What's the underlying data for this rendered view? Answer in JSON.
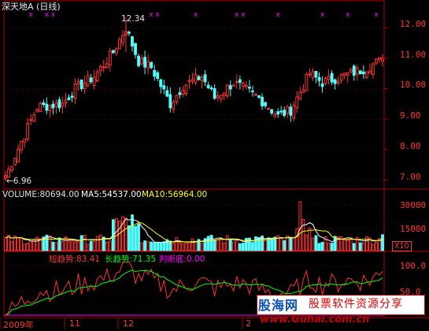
{
  "stock": {
    "title": "深天地A (日线)"
  },
  "price_panel": {
    "y_ticks": [
      "12.00",
      "11.00",
      "10.00",
      "9.00",
      "8.00",
      "7.00"
    ],
    "high_annotation": "12.34",
    "low_annotation": "←6.96"
  },
  "volume_panel": {
    "label_volume": "VOLUME:80694.00",
    "label_ma5": "MA5:54537.00",
    "label_ma10": "MA10:56964.00",
    "y_ticks": [
      "30000",
      "15000"
    ],
    "unit_badge": "X10"
  },
  "indicator_panel": {
    "label_short": "短趋势:83.41",
    "label_long": "长趋势:71.35",
    "label_judge": "判断底:0.00",
    "y_ticks": [
      "100.0",
      "50.0"
    ]
  },
  "x_axis": {
    "labels": [
      "2009年",
      "11",
      "12",
      "2"
    ]
  },
  "watermark": {
    "logo": "股海网",
    "slogan": "股票软件资源分享",
    "url": "www.Guhai.com.cn"
  },
  "colors": {
    "up": "#ff3232",
    "down": "#54fcfc",
    "background": "#000000",
    "ma5": "#ffffff",
    "ma10": "#ffff00",
    "short_trend": "#ff3232",
    "long_trend": "#00ff00",
    "judge": "#ff00ff",
    "marker": "#ff00ff"
  },
  "chart_data": {
    "type": "candlestick",
    "price_range": [
      6.7,
      12.6
    ],
    "candle_count": 120,
    "high": 12.34,
    "low": 6.96,
    "close_path_keypoints": [
      [
        0,
        7.1
      ],
      [
        6,
        8.5
      ],
      [
        10,
        9.4
      ],
      [
        18,
        9.5
      ],
      [
        22,
        10.0
      ],
      [
        28,
        10.4
      ],
      [
        34,
        11.2
      ],
      [
        38,
        12.0
      ],
      [
        42,
        10.9
      ],
      [
        46,
        10.7
      ],
      [
        52,
        9.5
      ],
      [
        56,
        10.1
      ],
      [
        62,
        10.4
      ],
      [
        66,
        9.7
      ],
      [
        72,
        10.2
      ],
      [
        80,
        9.7
      ],
      [
        86,
        9.1
      ],
      [
        90,
        9.3
      ],
      [
        96,
        10.5
      ],
      [
        100,
        10.2
      ],
      [
        106,
        10.4
      ],
      [
        112,
        10.6
      ],
      [
        118,
        10.9
      ],
      [
        119,
        11.0
      ]
    ],
    "volume_ma5": 54537.0,
    "volume_ma10": 56964.0,
    "volume_last": 80694.0,
    "short_trend_last": 83.41,
    "long_trend_last": 71.35,
    "judge_bottom_last": 0.0,
    "signal_marker_indices": [
      8,
      13,
      15,
      46,
      48,
      60,
      73,
      75,
      86,
      100,
      108,
      117
    ]
  }
}
